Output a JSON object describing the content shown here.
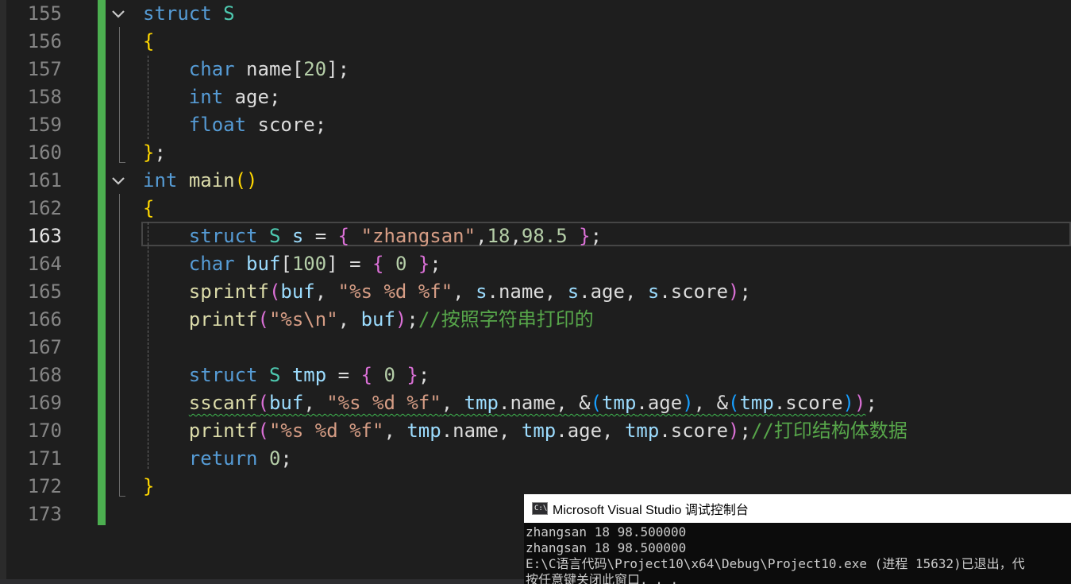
{
  "editor": {
    "current_line": "163",
    "lines": [
      {
        "n": "155"
      },
      {
        "n": "156"
      },
      {
        "n": "157"
      },
      {
        "n": "158"
      },
      {
        "n": "159"
      },
      {
        "n": "160"
      },
      {
        "n": "161"
      },
      {
        "n": "162"
      },
      {
        "n": "163"
      },
      {
        "n": "164"
      },
      {
        "n": "165"
      },
      {
        "n": "166"
      },
      {
        "n": "167"
      },
      {
        "n": "168"
      },
      {
        "n": "169"
      },
      {
        "n": "170"
      },
      {
        "n": "171"
      },
      {
        "n": "172"
      },
      {
        "n": "173"
      }
    ],
    "tokens": {
      "struct": "struct",
      "S": "S",
      "char": "char",
      "int": "int",
      "float": "float",
      "return": "return",
      "name20": "name",
      "twenty": "20",
      "age": "age",
      "score": "score",
      "main": "main",
      "s": "s",
      "zhangsan": "\"zhangsan\"",
      "n18": "18",
      "n985": "98.5",
      "buf": "buf",
      "n100": "100",
      "zero": "0",
      "sprintf": "sprintf",
      "printf": "printf",
      "sscanf": "sscanf",
      "fmt": "\"%s %d %f\"",
      "fmt_nl": "\"%s\\n\"",
      "tmp": "tmp",
      "comment1": "//按照字符串打印的",
      "comment2": "//打印结构体数据"
    }
  },
  "console": {
    "title": "Microsoft Visual Studio 调试控制台",
    "icon_label": "C:\\",
    "lines": [
      "zhangsan 18 98.500000",
      "zhangsan 18 98.500000",
      "E:\\C语言代码\\Project10\\x64\\Debug\\Project10.exe (进程 15632)已退出，代",
      "按任意键关闭此窗口. . ."
    ]
  },
  "colors": {
    "background": "#1e1e1e",
    "change_bar": "#4caf50",
    "keyword": "#569cd6",
    "type": "#4ec9b0",
    "string": "#d69d85",
    "comment": "#57a64a"
  }
}
